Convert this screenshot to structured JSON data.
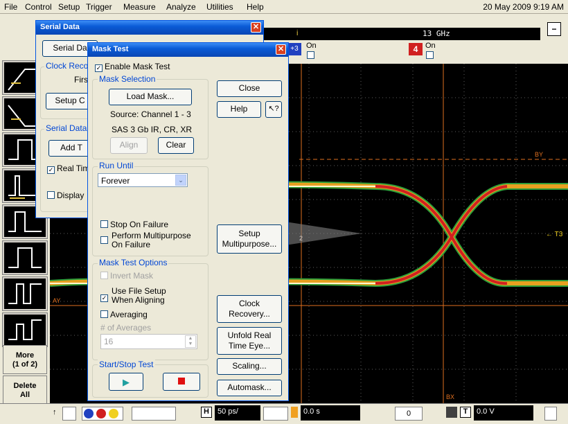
{
  "menu": [
    "File",
    "Control",
    "Setup",
    "Trigger",
    "Measure",
    "Analyze",
    "Utilities",
    "Help"
  ],
  "datetime": "20 May 2009 9:19 AM",
  "top": {
    "bandwidth": "13 GHz",
    "ch3_label": "On",
    "ch4_num": "4",
    "ch4_label": "On",
    "ch3_num": "+3",
    "minimize": "−"
  },
  "left": {
    "more": "More",
    "more_page": "(1 of 2)",
    "delete": "Delete",
    "delete2": "All"
  },
  "grid": {
    "marker_ay": "AY",
    "marker_by": "BY",
    "marker_bx": "BX",
    "marker_2": "2",
    "trig": "← T3"
  },
  "bottom": {
    "timebase": "50 ps/",
    "position": "0.0 s",
    "trig_level": "0.0 V",
    "acq": "0"
  },
  "serial": {
    "title": "Serial Data",
    "btn1": "Serial Da",
    "clock_group": "Clock Reco",
    "first": "Firs",
    "setup": "Setup C",
    "serial_group": "Serial Data",
    "add": "Add T",
    "real": "Real Tim",
    "display": "Display"
  },
  "mask": {
    "title": "Mask Test",
    "enable": "Enable Mask Test",
    "selection_group": "Mask Selection",
    "load": "Load Mask...",
    "source": "Source: Channel 1 - 3",
    "standard": "SAS 3 Gb IR, CR, XR",
    "align": "Align",
    "clear": "Clear",
    "close": "Close",
    "help": "Help",
    "whatsthis": "?",
    "run_group": "Run Until",
    "run_value": "Forever",
    "stop_fail": "Stop On Failure",
    "multi1": "Perform Multipurpose",
    "multi2": "On Failure",
    "setup_multi1": "Setup",
    "setup_multi2": "Multipurpose...",
    "options_group": "Mask Test Options",
    "invert": "Invert Mask",
    "filesetup1": "Use File Setup",
    "filesetup2": "When Aligning",
    "averaging": "Averaging",
    "num_avg": "# of Averages",
    "avg_value": "16",
    "clock1": "Clock",
    "clock2": "Recovery...",
    "unfold1": "Unfold Real",
    "unfold2": "Time Eye...",
    "scaling": "Scaling...",
    "startstop_group": "Start/Stop Test",
    "automask": "Automask..."
  },
  "colors": {
    "eye_outer": "#2e9e3a",
    "eye_mid": "#e8a020",
    "eye_core": "#d02020",
    "marker": "#e07020"
  }
}
